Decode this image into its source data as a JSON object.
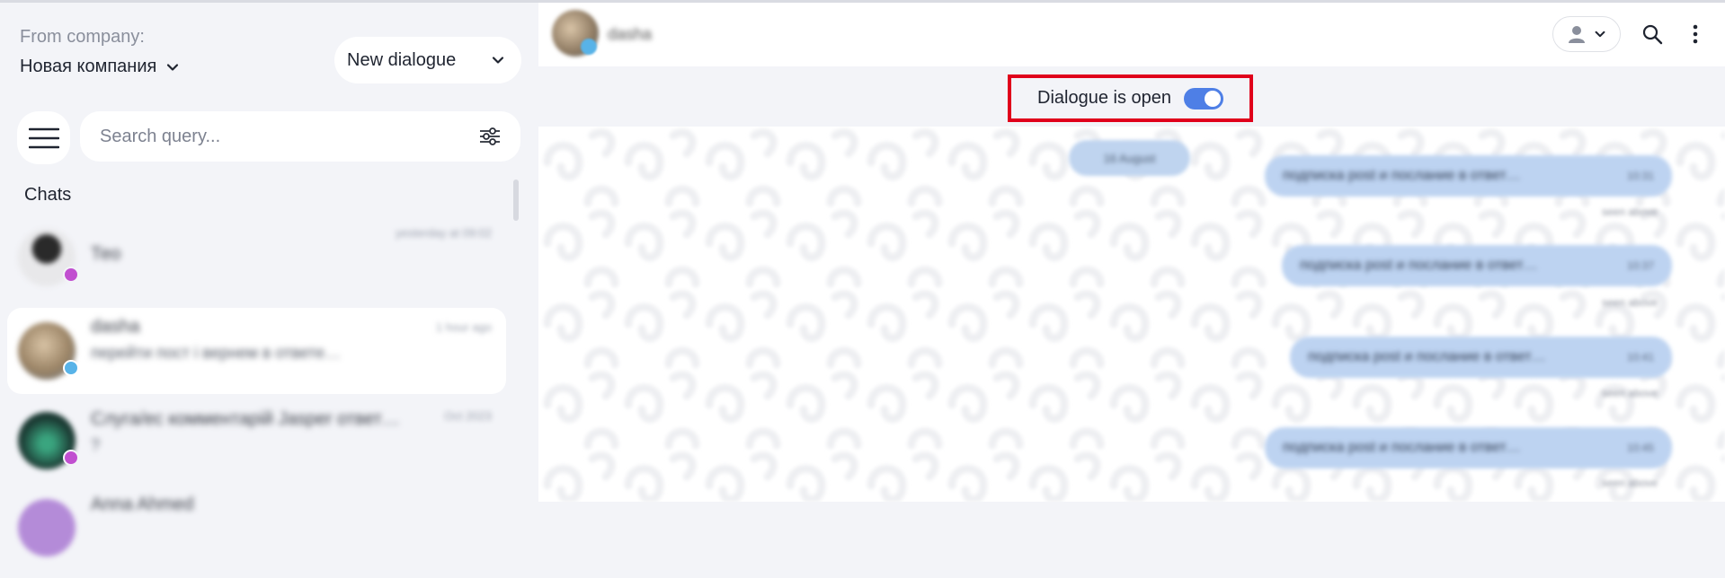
{
  "sidebar": {
    "from_label": "From company:",
    "company_name": "Новая компания",
    "new_dialogue_label": "New dialogue",
    "search_placeholder": "Search query...",
    "chats_heading": "Chats",
    "chats": [
      {
        "name": "Тео",
        "preview": "",
        "time": "yesterday at 09:02",
        "avatar_color": "#2a2a2a",
        "badge_color": "#c14fd0"
      },
      {
        "name": "dasha",
        "preview": "перейти пост і вернем в ответе…",
        "time": "1 hour ago",
        "avatar_color": "#a08a6b",
        "badge_color": "#58b3e8"
      },
      {
        "name": "Слуга/ес комментарій Jasper ответ…",
        "preview": "?",
        "time": "Oct 2023",
        "avatar_color": "#1f4a3b",
        "badge_color": "#c14fd0"
      },
      {
        "name": "Anna Ahmed",
        "preview": "",
        "time": "",
        "avatar_color": "#b48bd8",
        "badge_color": "#c14fd0"
      }
    ]
  },
  "chat": {
    "contact_name": "dasha",
    "dialogue_status_label": "Dialogue is open",
    "dialogue_open": true,
    "date_label": "16 August",
    "messages": [
      {
        "text": "подписка post и послание в ответ…",
        "time": "10:31",
        "meta": "seen above"
      },
      {
        "text": "подписка post и послание в ответ…",
        "time": "10:37",
        "meta": "seen above"
      },
      {
        "text": "подписка post и послание в ответ…",
        "time": "10:41",
        "meta": "seen above"
      },
      {
        "text": "подписка post и послание в ответ…",
        "time": "10:45",
        "meta": "seen above"
      }
    ]
  },
  "colors": {
    "accent": "#4e7fe6",
    "bubble": "#bdd3f1",
    "highlight_border": "#e0001b",
    "sidebar_bg": "#f3f4f8"
  }
}
